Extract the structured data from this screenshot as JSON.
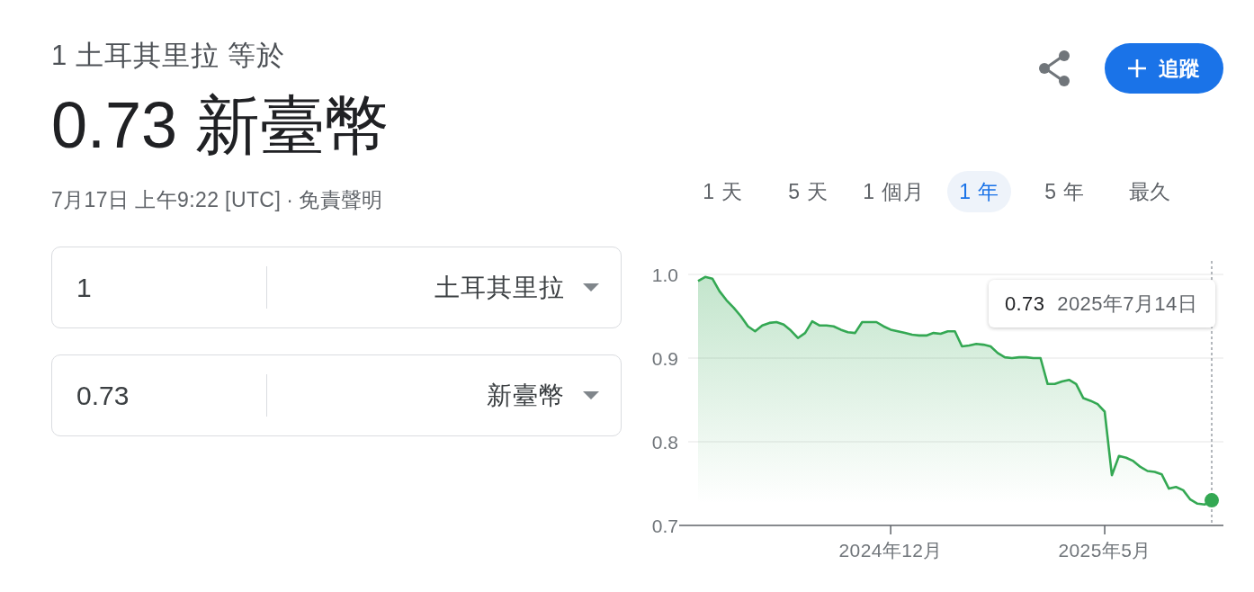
{
  "header": {
    "summary": "1 土耳其里拉 等於",
    "result": "0.73 新臺幣",
    "timestamp": "7月17日 上午9:22 [UTC]",
    "separator": "·",
    "disclaimer_link": "免責聲明"
  },
  "converter": [
    {
      "amount": "1",
      "currency": "土耳其里拉"
    },
    {
      "amount": "0.73",
      "currency": "新臺幣"
    }
  ],
  "toolbar": {
    "follow_button": {
      "label": "追蹤"
    }
  },
  "periods": [
    {
      "label": "1 天",
      "selected": false
    },
    {
      "label": "5 天",
      "selected": false
    },
    {
      "label": "1 個月",
      "selected": false
    },
    {
      "label": "1 年",
      "selected": true
    },
    {
      "label": "5 年",
      "selected": false
    },
    {
      "label": "最久",
      "selected": false
    }
  ],
  "chart": {
    "chart_data": {
      "type": "area",
      "categories": [
        null,
        null,
        null,
        null,
        null,
        null,
        null,
        null,
        null,
        null,
        null,
        null,
        null,
        null,
        null,
        null,
        null,
        null,
        null,
        null,
        null,
        null,
        null,
        null,
        null,
        null,
        null,
        "2024年12月",
        null,
        null,
        null,
        null,
        null,
        null,
        null,
        null,
        null,
        null,
        null,
        null,
        null,
        null,
        null,
        null,
        null,
        null,
        null,
        null,
        null,
        null,
        null,
        null,
        null,
        null,
        null,
        null,
        null,
        "2025年5月",
        null,
        null,
        null,
        null,
        null,
        null,
        null,
        null,
        null,
        null,
        null,
        null,
        null,
        null,
        null
      ],
      "series": [
        {
          "color": "#34a853",
          "values": [
            0.992,
            0.997,
            0.995,
            0.98,
            0.969,
            0.96,
            0.95,
            0.938,
            0.932,
            0.939,
            0.942,
            0.943,
            0.94,
            0.933,
            0.924,
            0.93,
            0.944,
            0.939,
            0.939,
            0.938,
            0.934,
            0.931,
            0.93,
            0.943,
            0.943,
            0.943,
            0.938,
            0.934,
            0.932,
            0.93,
            0.928,
            0.927,
            0.927,
            0.93,
            0.929,
            0.932,
            0.932,
            0.914,
            0.915,
            0.917,
            0.916,
            0.914,
            0.906,
            0.901,
            0.9,
            0.901,
            0.901,
            0.9,
            0.9,
            0.869,
            0.869,
            0.872,
            0.874,
            0.869,
            0.852,
            0.849,
            0.845,
            0.836,
            0.76,
            0.783,
            0.781,
            0.777,
            0.77,
            0.765,
            0.764,
            0.761,
            0.744,
            0.746,
            0.742,
            0.731,
            0.726,
            0.725,
            0.73
          ]
        }
      ],
      "ylim": [
        0.7,
        1.0
      ],
      "yticks": [
        {
          "value": 0.7,
          "label": "0.7"
        },
        {
          "value": 0.8,
          "label": "0.8"
        },
        {
          "value": 0.9,
          "label": "0.9"
        },
        {
          "value": 1.0,
          "label": "1.0"
        }
      ]
    },
    "tooltip": {
      "value": "0.73",
      "date": "2025年7月14日"
    }
  }
}
